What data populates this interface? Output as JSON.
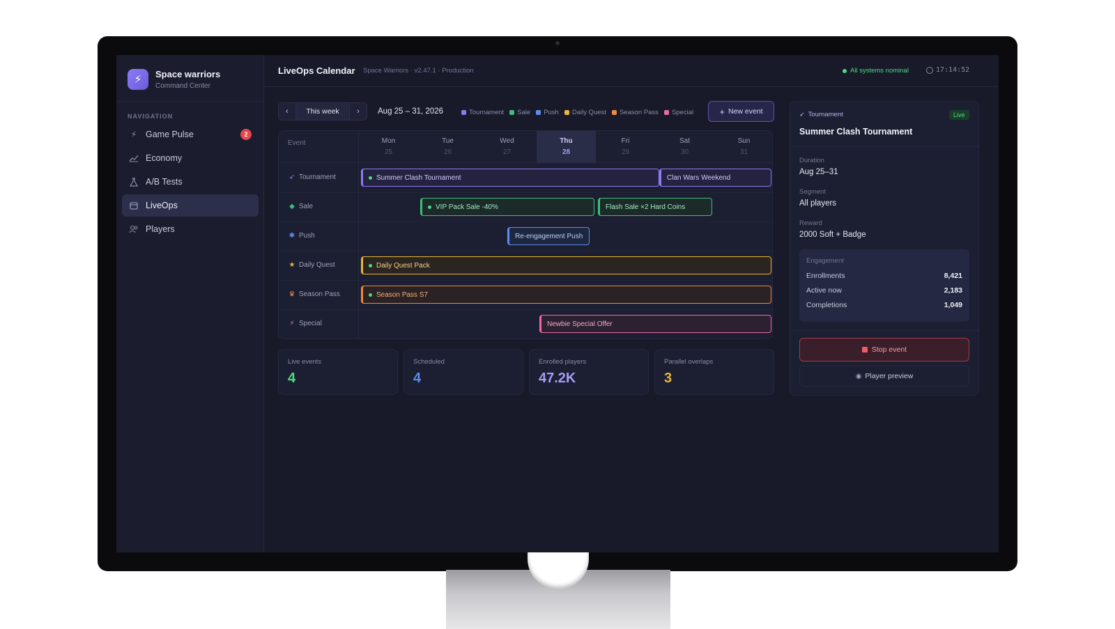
{
  "brand": {
    "title": "Space warriors",
    "subtitle": "Command Center"
  },
  "nav": {
    "label": "NAVIGATION",
    "items": [
      {
        "label": "Game Pulse",
        "icon": "bolt-icon",
        "badge": "2"
      },
      {
        "label": "Economy",
        "icon": "chart-line-icon"
      },
      {
        "label": "A/B Tests",
        "icon": "flask-icon"
      },
      {
        "label": "LiveOps",
        "icon": "calendar-icon",
        "active": true
      },
      {
        "label": "Players",
        "icon": "users-icon"
      }
    ]
  },
  "header": {
    "title": "LiveOps Calendar",
    "subtitle": "Space Warriors · v2.47.1 · Production",
    "status": "All systems nominal",
    "time": "17:14:52"
  },
  "toolbar": {
    "this_week": "This week",
    "date_range": "Aug 25 – 31, 2026",
    "new_event": "New event",
    "legend": [
      {
        "label": "Tournament",
        "color": "#8b7cf6"
      },
      {
        "label": "Sale",
        "color": "#3fbf75"
      },
      {
        "label": "Push",
        "color": "#5b8def"
      },
      {
        "label": "Daily Quest",
        "color": "#e9b63a"
      },
      {
        "label": "Season Pass",
        "color": "#f08a3e"
      },
      {
        "label": "Special",
        "color": "#ec6aa8"
      }
    ]
  },
  "calendar": {
    "event_col": "Event",
    "days": [
      {
        "name": "Mon",
        "num": "25"
      },
      {
        "name": "Tue",
        "num": "26"
      },
      {
        "name": "Wed",
        "num": "27"
      },
      {
        "name": "Thu",
        "num": "28",
        "today": true
      },
      {
        "name": "Fri",
        "num": "29"
      },
      {
        "name": "Sat",
        "num": "30"
      },
      {
        "name": "Sun",
        "num": "31"
      }
    ],
    "rows": [
      {
        "label": "Tournament",
        "icon": "rocket-icon"
      },
      {
        "label": "Sale",
        "icon": "tag-icon"
      },
      {
        "label": "Push",
        "icon": "snowflake-icon"
      },
      {
        "label": "Daily Quest",
        "icon": "star-icon"
      },
      {
        "label": "Season Pass",
        "icon": "crown-icon"
      },
      {
        "label": "Special",
        "icon": "bolt-icon"
      }
    ],
    "events": {
      "summer_clash": "Summer Clash Tournament",
      "clan_wars": "Clan Wars Weekend",
      "vip_pack": "VIP Pack Sale -40%",
      "flash_sale": "Flash Sale ×2 Hard Coins",
      "reengagement": "Re-engagement Push",
      "daily_quest": "Daily Quest Pack",
      "season_pass": "Season Pass S7",
      "newbie": "Newbie Special Offer"
    }
  },
  "stats": [
    {
      "label": "Live events",
      "value": "4",
      "color": "#4ade80"
    },
    {
      "label": "Scheduled",
      "value": "4",
      "color": "#5b8def"
    },
    {
      "label": "Enrolled players",
      "value": "47.2K",
      "color": "#a49cf5"
    },
    {
      "label": "Parallel overlaps",
      "value": "3",
      "color": "#e9b63a"
    }
  ],
  "detail": {
    "type": "Tournament",
    "badge": "Live",
    "title": "Summer Clash Tournament",
    "duration_label": "Duration",
    "duration": "Aug 25–31",
    "segment_label": "Segment",
    "segment": "All players",
    "reward_label": "Reward",
    "reward": "2000 Soft + Badge",
    "engagement": {
      "title": "Engagement",
      "rows": [
        {
          "label": "Enrollments",
          "value": "8,421"
        },
        {
          "label": "Active now",
          "value": "2,183"
        },
        {
          "label": "Completions",
          "value": "1,049"
        }
      ]
    },
    "stop": "Stop event",
    "preview": "Player preview"
  }
}
